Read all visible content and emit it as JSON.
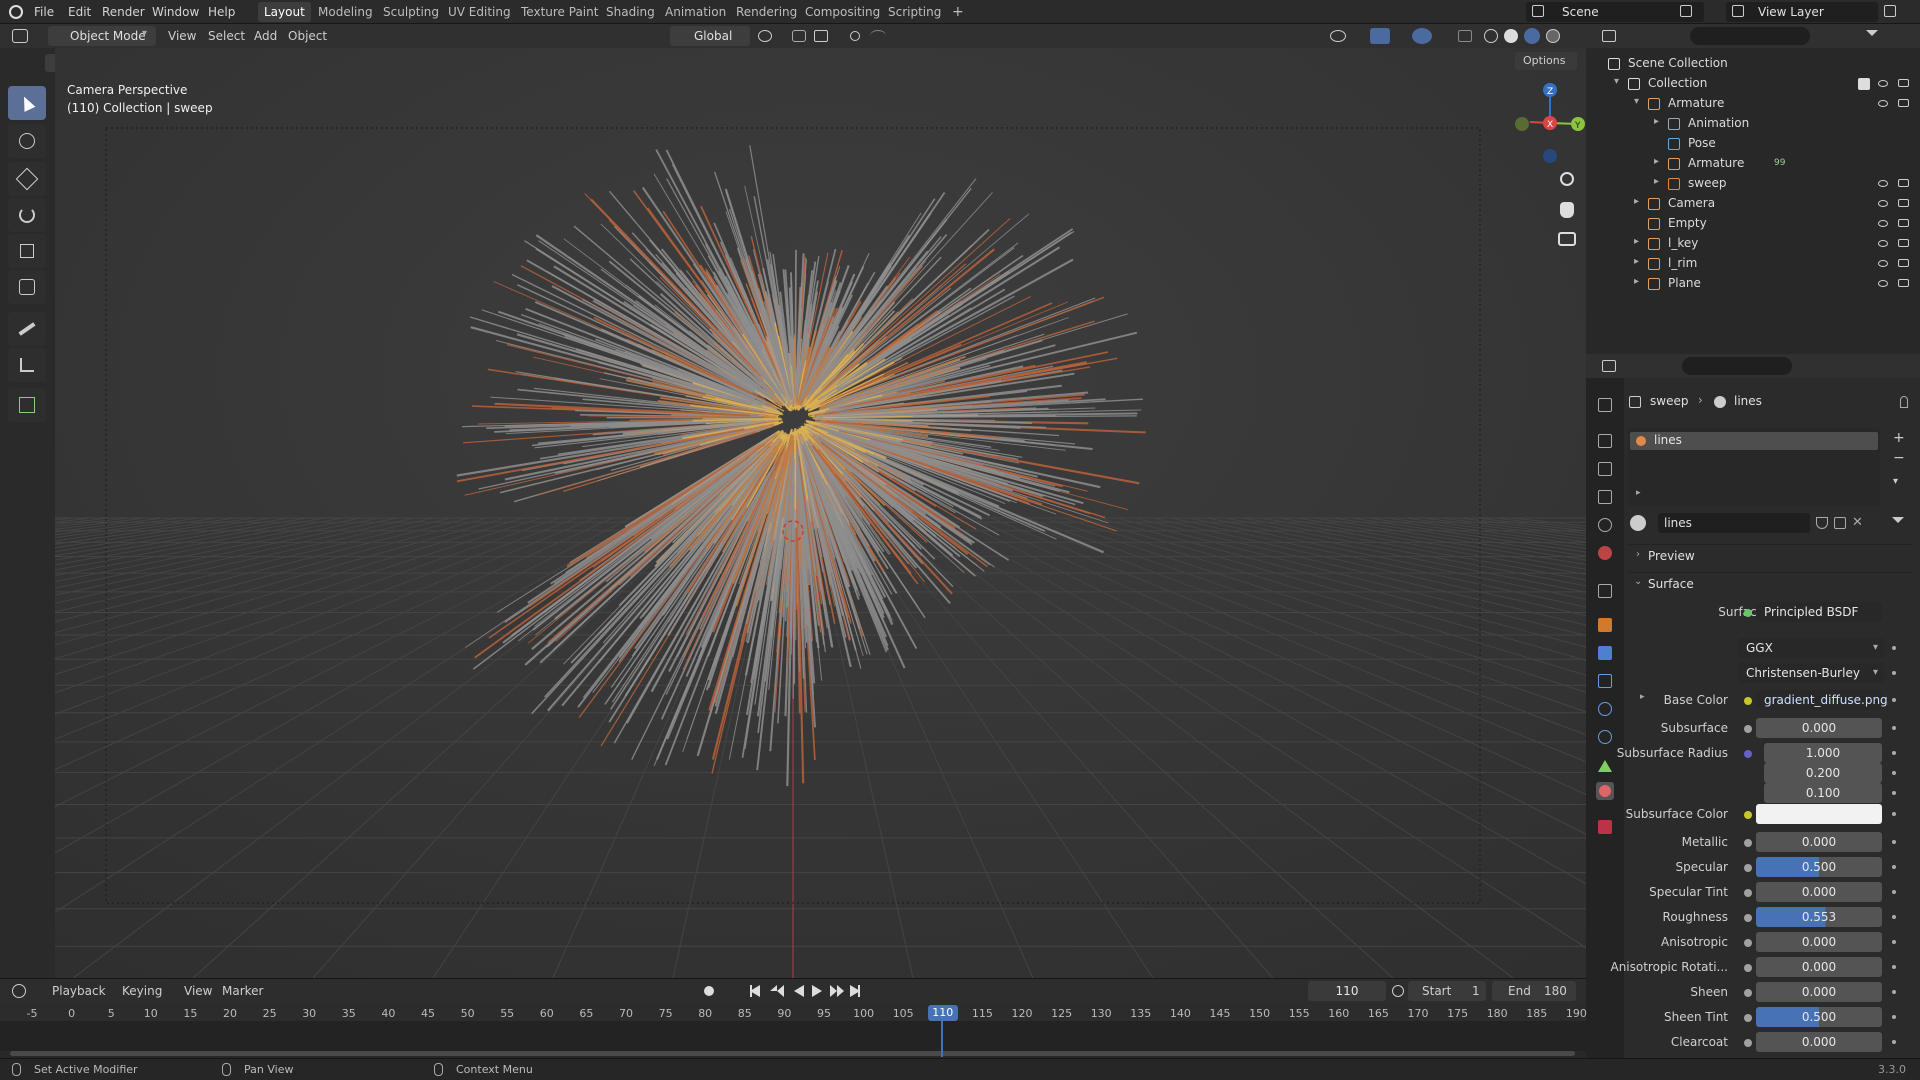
{
  "top_menu": [
    "File",
    "Edit",
    "Render",
    "Window",
    "Help"
  ],
  "workspaces": [
    "Layout",
    "Modeling",
    "Sculpting",
    "UV Editing",
    "Texture Paint",
    "Shading",
    "Animation",
    "Rendering",
    "Compositing",
    "Scripting"
  ],
  "workspace_add": "+",
  "scene": "Scene",
  "view_layer": "View Layer",
  "viewport_header": {
    "mode": "Object Mode",
    "menus": [
      "View",
      "Select",
      "Add",
      "Object"
    ],
    "orientation": "Global",
    "options": "Options"
  },
  "viewport": {
    "title": "Camera Perspective",
    "subtitle": "(110) Collection | sweep",
    "gizmo": {
      "x": "X",
      "y": "Y",
      "z": "Z"
    }
  },
  "outliner": {
    "items": [
      {
        "label": "Scene Collection",
        "depth": 0,
        "expand": ""
      },
      {
        "label": "Collection",
        "depth": 1,
        "expand": "▾"
      },
      {
        "label": "Armature",
        "depth": 2,
        "expand": "▾"
      },
      {
        "label": "Animation",
        "depth": 3,
        "expand": "▸"
      },
      {
        "label": "Pose",
        "depth": 3,
        "expand": ""
      },
      {
        "label": "Armature",
        "depth": 3,
        "expand": "▸"
      },
      {
        "label": "sweep",
        "depth": 3,
        "expand": "▸"
      },
      {
        "label": "Camera",
        "depth": 2,
        "expand": "▸"
      },
      {
        "label": "Empty",
        "depth": 2,
        "expand": ""
      },
      {
        "label": "l_key",
        "depth": 2,
        "expand": "▸"
      },
      {
        "label": "l_rim",
        "depth": 2,
        "expand": "▸"
      },
      {
        "label": "Plane",
        "depth": 2,
        "expand": "▸"
      }
    ],
    "armature_badge": "99"
  },
  "properties": {
    "breadcrumb": [
      "sweep",
      "lines"
    ],
    "slot": "lines",
    "material_name": "lines",
    "preview": "Preview",
    "surface_panel": "Surface",
    "surface_label": "Surface",
    "surface_value": "Principled BSDF",
    "distribution": "GGX",
    "subsurface_method": "Christensen-Burley",
    "base_color_label": "Base Color",
    "base_color_value": "gradient_diffuse.png",
    "subsurface_color_label": "Subsurface Color",
    "fields": [
      {
        "label": "Subsurface",
        "value": "0.000",
        "fill": 0
      },
      {
        "label": "Subsurface Radius",
        "value": "1.000",
        "fill": 0
      },
      {
        "label": "",
        "value": "0.200",
        "fill": 0
      },
      {
        "label": "",
        "value": "0.100",
        "fill": 0
      },
      {
        "label": "Metallic",
        "value": "0.000",
        "fill": 0
      },
      {
        "label": "Specular",
        "value": "0.500",
        "fill": 0.5
      },
      {
        "label": "Specular Tint",
        "value": "0.000",
        "fill": 0
      },
      {
        "label": "Roughness",
        "value": "0.553",
        "fill": 0.553
      },
      {
        "label": "Anisotropic",
        "value": "0.000",
        "fill": 0
      },
      {
        "label": "Anisotropic Rotati...",
        "value": "0.000",
        "fill": 0
      },
      {
        "label": "Sheen",
        "value": "0.000",
        "fill": 0
      },
      {
        "label": "Sheen Tint",
        "value": "0.500",
        "fill": 0.5
      },
      {
        "label": "Clearcoat",
        "value": "0.000",
        "fill": 0
      }
    ]
  },
  "timeline": {
    "menus": [
      "Playback",
      "Keying",
      "View",
      "Marker"
    ],
    "current_frame": "110",
    "start_label": "Start",
    "start": "1",
    "end_label": "End",
    "end": "180",
    "ticks": [
      "-5",
      "0",
      "5",
      "10",
      "15",
      "20",
      "25",
      "30",
      "35",
      "40",
      "45",
      "50",
      "55",
      "60",
      "65",
      "70",
      "75",
      "80",
      "85",
      "90",
      "95",
      "100",
      "105",
      "110",
      "115",
      "120",
      "125",
      "130",
      "135",
      "140",
      "145",
      "150",
      "155",
      "160",
      "165",
      "170",
      "175",
      "180",
      "185",
      "190"
    ]
  },
  "status_bar": {
    "items": [
      "Set Active Modifier",
      "Pan View",
      "Context Menu"
    ],
    "version": "3.3.0"
  }
}
